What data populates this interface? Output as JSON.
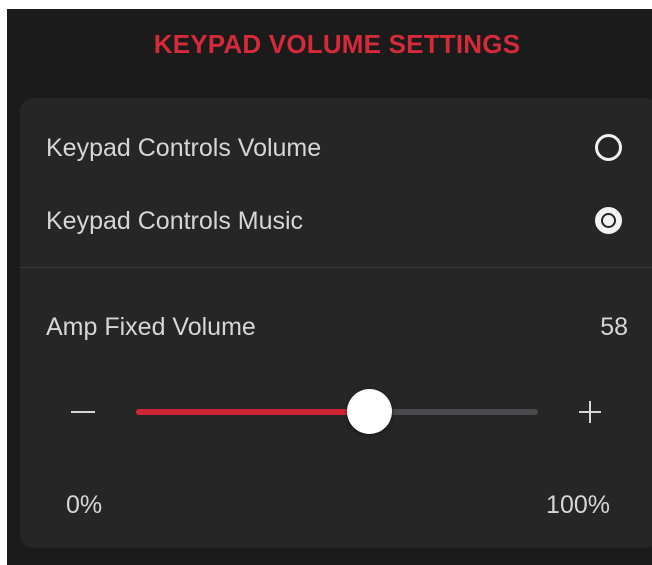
{
  "header": {
    "title": "KEYPAD VOLUME SETTINGS"
  },
  "options": [
    {
      "label": "Keypad Controls Volume",
      "selected": false
    },
    {
      "label": "Keypad Controls Music",
      "selected": true
    }
  ],
  "amp": {
    "label": "Amp Fixed Volume",
    "value": "58",
    "level_percent": 58,
    "range_min_label": "0%",
    "range_max_label": "100%",
    "minus_icon": "minus-icon",
    "plus_icon": "plus-icon"
  },
  "colors": {
    "accent": "#d42a3a",
    "slider_fill": "#cc2634",
    "slider_track": "#4a4a4e",
    "background": "#1b1b1b",
    "card": "#262626"
  }
}
